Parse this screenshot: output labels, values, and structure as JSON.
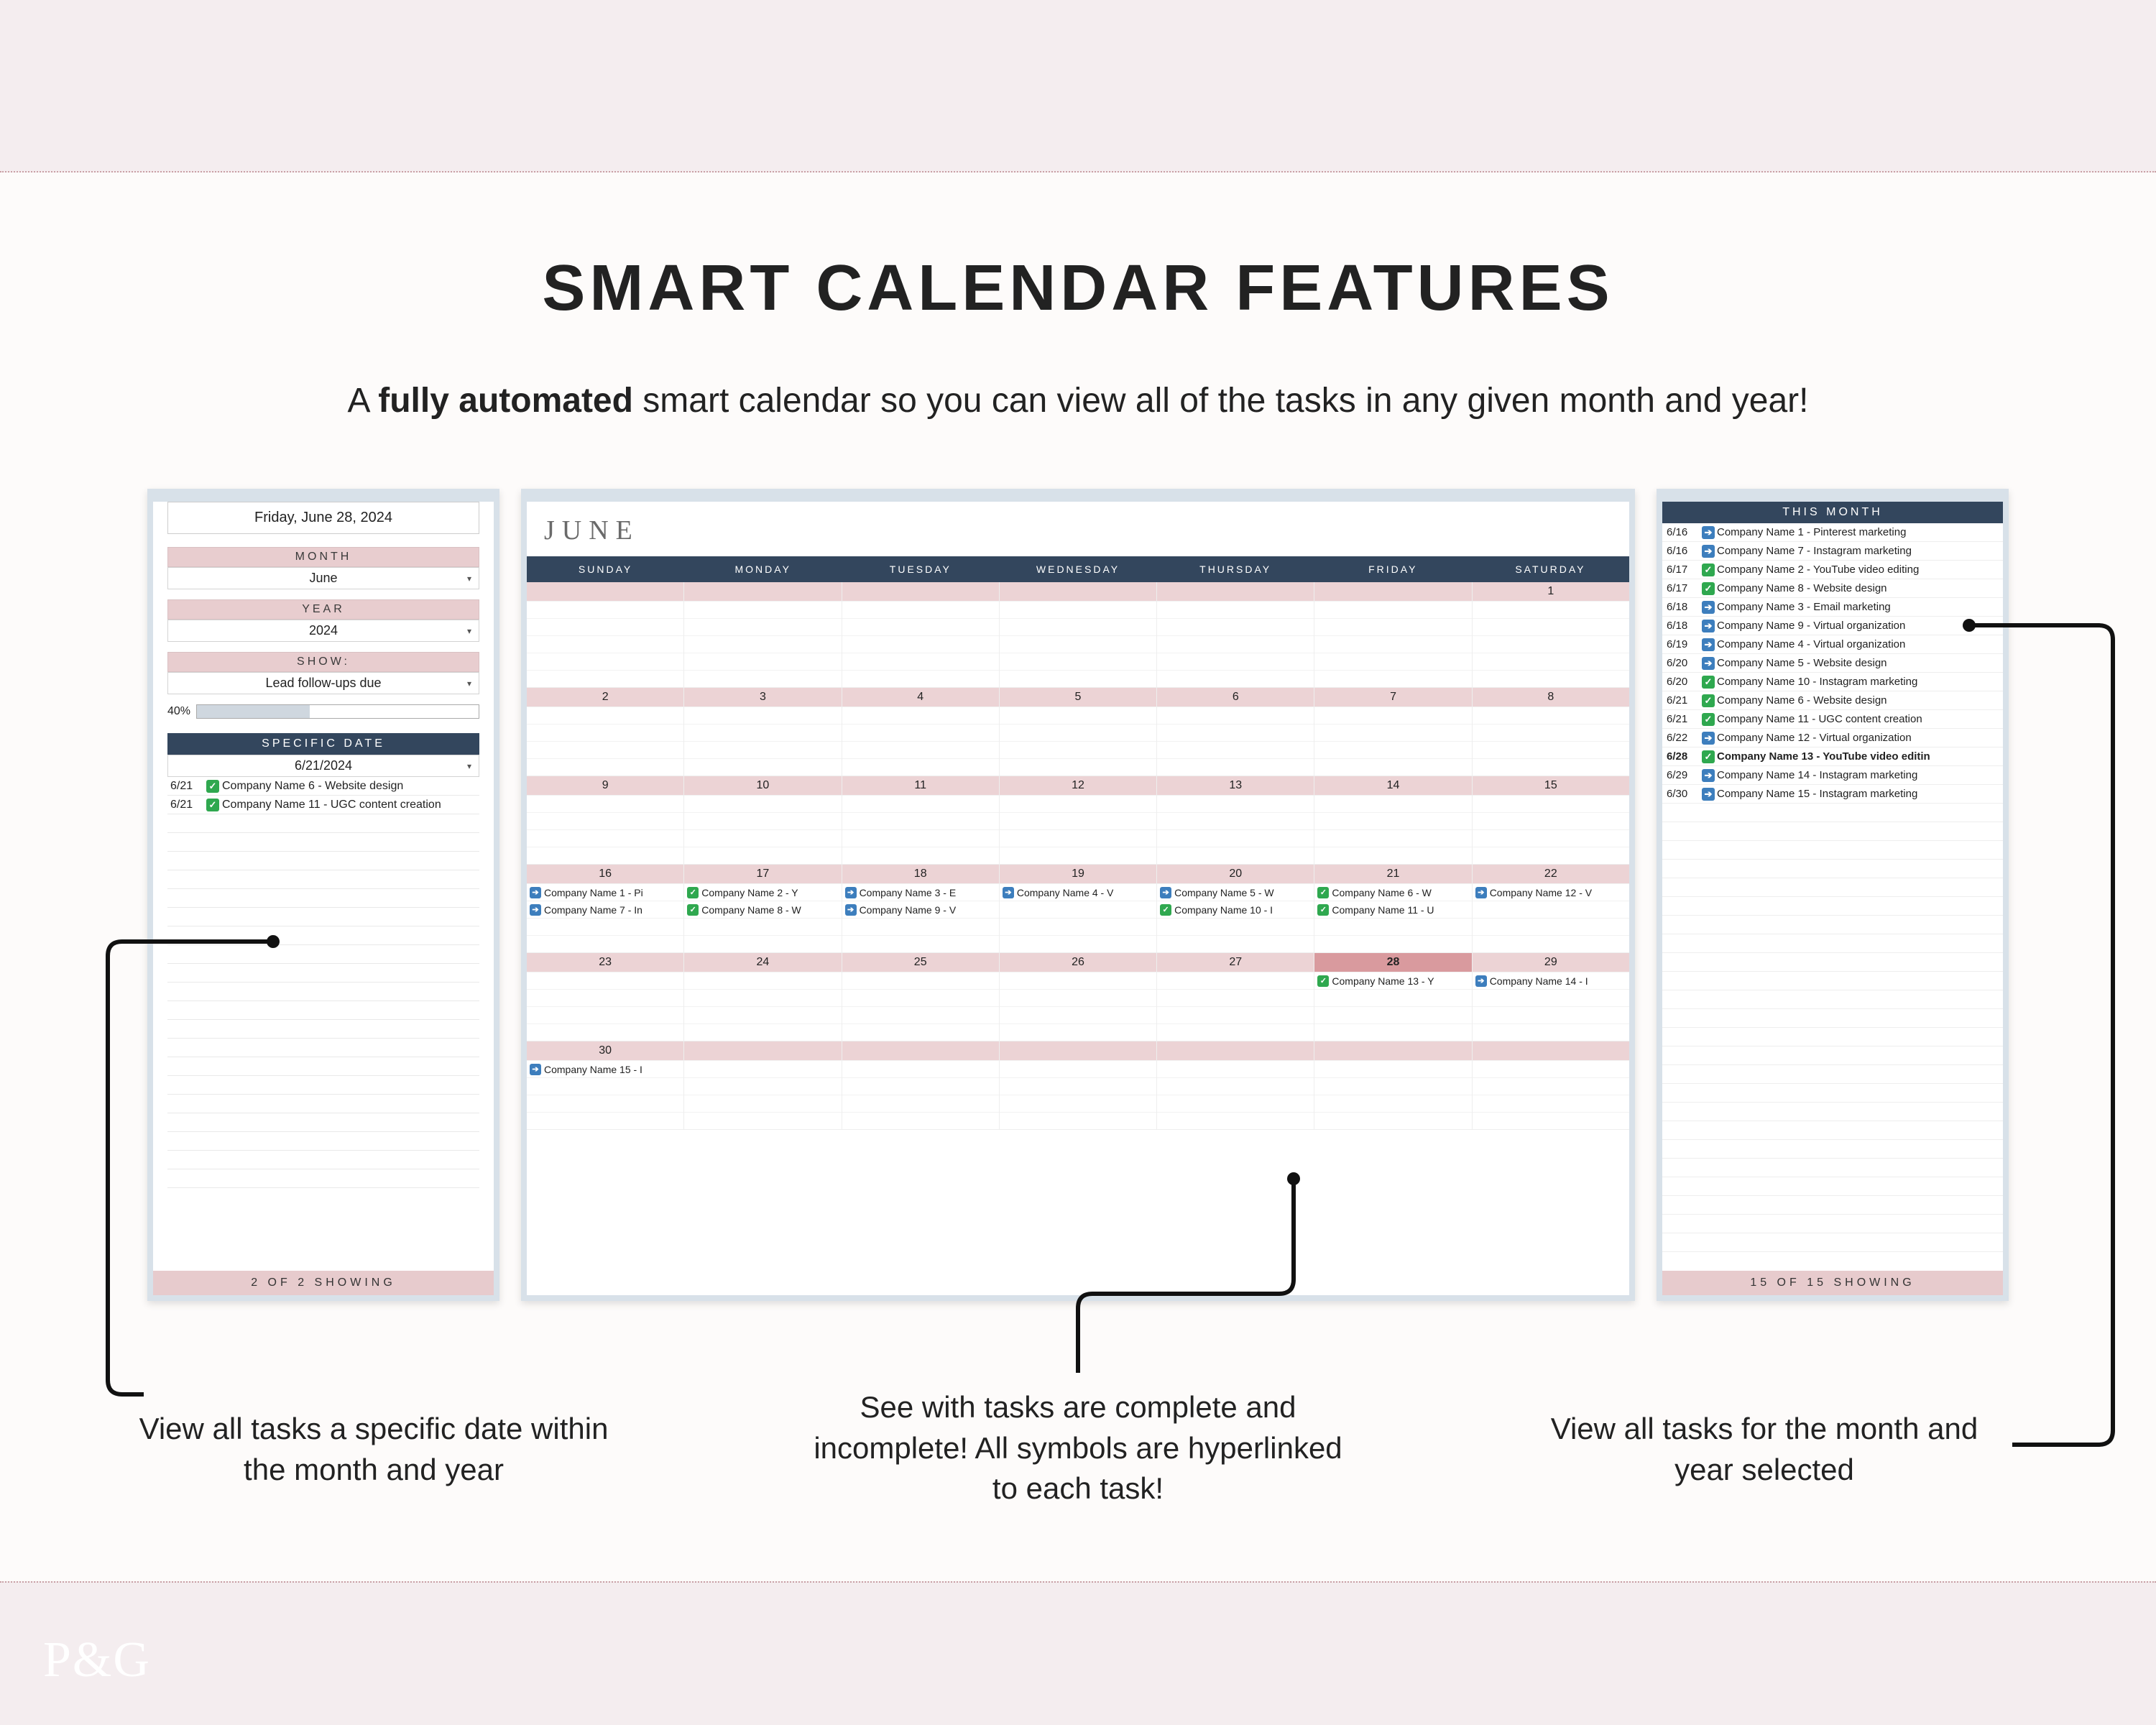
{
  "header": {
    "title": "SMART CALENDAR FEATURES",
    "sub_before": "A ",
    "sub_bold": "fully automated",
    "sub_after": " smart calendar so you can view all of the tasks in any given month and year!"
  },
  "left_panel": {
    "date_display": "Friday, June 28, 2024",
    "month_label": "MONTH",
    "month_value": "June",
    "year_label": "YEAR",
    "year_value": "2024",
    "show_label": "SHOW:",
    "show_value": "Lead follow-ups due",
    "progress_pct": "40%",
    "specific_date_label": "SPECIFIC DATE",
    "specific_date_value": "6/21/2024",
    "tasks": [
      {
        "date": "6/21",
        "done": true,
        "text": "Company Name 6 - Website design"
      },
      {
        "date": "6/21",
        "done": true,
        "text": "Company Name 11 - UGC content creation"
      }
    ],
    "footer": "2 OF 2 SHOWING"
  },
  "calendar": {
    "month_title": "JUNE",
    "day_headers": [
      "SUNDAY",
      "MONDAY",
      "TUESDAY",
      "WEDNESDAY",
      "THURSDAY",
      "FRIDAY",
      "SATURDAY"
    ],
    "weeks": [
      {
        "days": [
          {
            "num": "",
            "tasks": []
          },
          {
            "num": "",
            "tasks": []
          },
          {
            "num": "",
            "tasks": []
          },
          {
            "num": "",
            "tasks": []
          },
          {
            "num": "",
            "tasks": []
          },
          {
            "num": "",
            "tasks": []
          },
          {
            "num": "1",
            "tasks": []
          }
        ],
        "slots": 5
      },
      {
        "days": [
          {
            "num": "2",
            "tasks": []
          },
          {
            "num": "3",
            "tasks": []
          },
          {
            "num": "4",
            "tasks": []
          },
          {
            "num": "5",
            "tasks": []
          },
          {
            "num": "6",
            "tasks": []
          },
          {
            "num": "7",
            "tasks": []
          },
          {
            "num": "8",
            "tasks": []
          }
        ],
        "slots": 4
      },
      {
        "days": [
          {
            "num": "9",
            "tasks": []
          },
          {
            "num": "10",
            "tasks": []
          },
          {
            "num": "11",
            "tasks": []
          },
          {
            "num": "12",
            "tasks": []
          },
          {
            "num": "13",
            "tasks": []
          },
          {
            "num": "14",
            "tasks": []
          },
          {
            "num": "15",
            "tasks": []
          }
        ],
        "slots": 4
      },
      {
        "days": [
          {
            "num": "16",
            "tasks": [
              {
                "done": false,
                "text": "Company Name 1 - Pi"
              },
              {
                "done": false,
                "text": "Company Name 7 - In"
              }
            ]
          },
          {
            "num": "17",
            "tasks": [
              {
                "done": true,
                "text": "Company Name 2 - Y"
              },
              {
                "done": true,
                "text": "Company Name 8 - W"
              }
            ]
          },
          {
            "num": "18",
            "tasks": [
              {
                "done": false,
                "text": "Company Name 3 - E"
              },
              {
                "done": false,
                "text": "Company Name 9 - V"
              }
            ]
          },
          {
            "num": "19",
            "tasks": [
              {
                "done": false,
                "text": "Company Name 4 - V"
              }
            ]
          },
          {
            "num": "20",
            "tasks": [
              {
                "done": false,
                "text": "Company Name 5 - W"
              },
              {
                "done": true,
                "text": "Company Name 10 - I"
              }
            ]
          },
          {
            "num": "21",
            "tasks": [
              {
                "done": true,
                "text": "Company Name 6 - W"
              },
              {
                "done": true,
                "text": "Company Name 11 - U"
              }
            ]
          },
          {
            "num": "22",
            "tasks": [
              {
                "done": false,
                "text": "Company Name 12 - V"
              }
            ]
          }
        ],
        "slots": 4
      },
      {
        "days": [
          {
            "num": "23",
            "tasks": []
          },
          {
            "num": "24",
            "tasks": []
          },
          {
            "num": "25",
            "tasks": []
          },
          {
            "num": "26",
            "tasks": []
          },
          {
            "num": "27",
            "tasks": []
          },
          {
            "num": "28",
            "today": true,
            "tasks": [
              {
                "done": true,
                "text": "Company Name 13 - Y"
              }
            ]
          },
          {
            "num": "29",
            "tasks": [
              {
                "done": false,
                "text": "Company Name 14 - I"
              }
            ]
          }
        ],
        "slots": 4
      },
      {
        "days": [
          {
            "num": "30",
            "tasks": [
              {
                "done": false,
                "text": "Company Name 15 - I"
              }
            ]
          },
          {
            "num": "",
            "tasks": []
          },
          {
            "num": "",
            "tasks": []
          },
          {
            "num": "",
            "tasks": []
          },
          {
            "num": "",
            "tasks": []
          },
          {
            "num": "",
            "tasks": []
          },
          {
            "num": "",
            "tasks": []
          }
        ],
        "slots": 4
      }
    ]
  },
  "right_panel": {
    "header": "THIS MONTH",
    "tasks": [
      {
        "date": "6/16",
        "done": false,
        "text": "Company Name 1 - Pinterest marketing"
      },
      {
        "date": "6/16",
        "done": false,
        "text": "Company Name 7 - Instagram marketing"
      },
      {
        "date": "6/17",
        "done": true,
        "text": "Company Name 2 - YouTube video editing"
      },
      {
        "date": "6/17",
        "done": true,
        "text": "Company Name 8 - Website design"
      },
      {
        "date": "6/18",
        "done": false,
        "text": "Company Name 3 - Email marketing"
      },
      {
        "date": "6/18",
        "done": false,
        "text": "Company Name 9 - Virtual organization"
      },
      {
        "date": "6/19",
        "done": false,
        "text": "Company Name 4 - Virtual organization"
      },
      {
        "date": "6/20",
        "done": false,
        "text": "Company Name 5 - Website design"
      },
      {
        "date": "6/20",
        "done": true,
        "text": "Company Name 10 - Instagram marketing"
      },
      {
        "date": "6/21",
        "done": true,
        "text": "Company Name 6 - Website design"
      },
      {
        "date": "6/21",
        "done": true,
        "text": "Company Name 11 - UGC content creation"
      },
      {
        "date": "6/22",
        "done": false,
        "text": "Company Name 12 - Virtual organization"
      },
      {
        "date": "6/28",
        "done": true,
        "bold": true,
        "text": "Company Name 13 - YouTube video editin"
      },
      {
        "date": "6/29",
        "done": false,
        "text": "Company Name 14 - Instagram marketing"
      },
      {
        "date": "6/30",
        "done": false,
        "text": "Company Name 15 - Instagram marketing"
      }
    ],
    "footer": "15 OF 15 SHOWING"
  },
  "callouts": {
    "left": "View all tasks a specific date within the month and year",
    "mid": "See with tasks are complete and incomplete! All symbols are hyperlinked to each task!",
    "right": "View all tasks for the month and year selected"
  },
  "logo": "P&G"
}
